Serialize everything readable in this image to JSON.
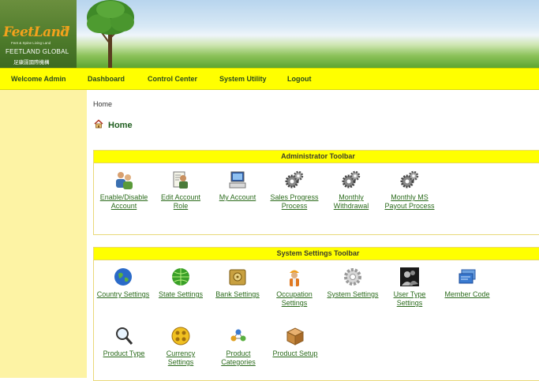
{
  "brand": {
    "logo": "FeetLand",
    "logo_tm": "TM",
    "tagline": "Feet & Spine Living Land",
    "company": "FEETLAND GLOBAL",
    "company_cn": "足康園國際機構"
  },
  "nav": {
    "items": [
      {
        "label": "Welcome Admin"
      },
      {
        "label": "Dashboard"
      },
      {
        "label": "Control Center"
      },
      {
        "label": "System Utility"
      },
      {
        "label": "Logout"
      }
    ]
  },
  "breadcrumb": "Home",
  "page_title": "Home",
  "admin_toolbar": {
    "title": "Administrator Toolbar",
    "tools": [
      {
        "line1": "Enable/Disable",
        "line2": "Account",
        "icon": "users-icon"
      },
      {
        "line1": "Edit Account",
        "line2": "Role",
        "icon": "user-edit-icon"
      },
      {
        "line1": "My Account",
        "line2": "",
        "icon": "computer-icon"
      },
      {
        "line1": "Sales Progress",
        "line2": "Process",
        "icon": "gears-icon"
      },
      {
        "line1": "Monthly",
        "line2": "Withdrawal",
        "icon": "gears-icon"
      },
      {
        "line1": "Monthly MS",
        "line2": "Payout Process",
        "icon": "gears-icon"
      }
    ]
  },
  "system_toolbar": {
    "title": "System Settings Toolbar",
    "tools": [
      {
        "line1": "Country Settings",
        "line2": "",
        "icon": "globe-icon"
      },
      {
        "line1": "State Settings",
        "line2": "",
        "icon": "globe-green-icon"
      },
      {
        "line1": "Bank Settings",
        "line2": "",
        "icon": "safe-icon"
      },
      {
        "line1": "Occupation",
        "line2": "Settings",
        "icon": "worker-icon"
      },
      {
        "line1": "System Settings",
        "line2": "",
        "icon": "gear-icon"
      },
      {
        "line1": "User Type",
        "line2": "Settings",
        "icon": "user-silhouette-icon"
      },
      {
        "line1": "Member Code",
        "line2": "",
        "icon": "cards-icon"
      },
      {
        "line1": "Product Type",
        "line2": "",
        "icon": "magnifier-icon"
      },
      {
        "line1": "Currency",
        "line2": "Settings",
        "icon": "currency-icon"
      },
      {
        "line1": "Product",
        "line2": "Categories",
        "icon": "molecule-icon"
      },
      {
        "line1": "Product Setup",
        "line2": "",
        "icon": "box-icon"
      }
    ]
  },
  "colors": {
    "nav_bg": "#ffff00",
    "sidebar_bg": "#fdf3a4",
    "link": "#2b6b1c",
    "logo": "#f3a21c"
  }
}
